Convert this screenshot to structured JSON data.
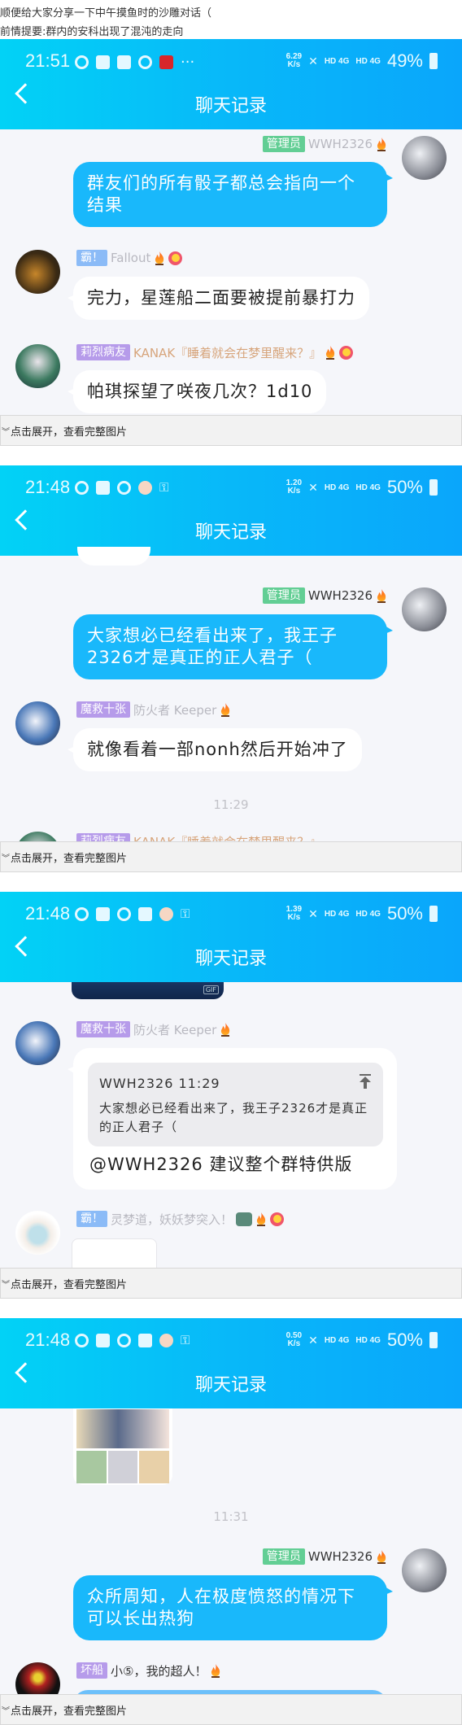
{
  "intro": {
    "line1": "顺便给大家分享一下中午摸鱼时的沙雕对话（",
    "line2": "前情提要:群内的安科出现了混沌的走向"
  },
  "colors": {
    "header_start": "#02d2f6",
    "header_end": "#0aa6fb",
    "bubble_self": "#19b8fb",
    "badge_admin": "#62ce94",
    "badge_blue": "#8bbbf7",
    "badge_purple": "#b69bea",
    "background": "#f5f6fa"
  },
  "expand_label": "点击展开，查看完整图片",
  "panels": [
    {
      "status": {
        "time": "21:51",
        "speed_top": "6.29",
        "speed_unit": "K/s",
        "net1": "HD 4G",
        "net2": "HD 4G",
        "battery": "49%"
      },
      "title": "聊天记录",
      "messages": [
        {
          "side": "right",
          "badge": "管理员",
          "name": "WWH2326",
          "text": "群友们的所有骰子都总会指向一个结果"
        },
        {
          "side": "left",
          "badge": "霸！",
          "name": "Fallout",
          "text": "完力，星莲船二面要被提前暴打力"
        },
        {
          "side": "left",
          "badge": "莉烈病友",
          "name": "KANAK『睡着就会在梦里醒来？』",
          "text": "帕琪探望了咲夜几次？1d10"
        }
      ]
    },
    {
      "status": {
        "time": "21:48",
        "speed_top": "1.20",
        "speed_unit": "K/s",
        "net1": "HD 4G",
        "net2": "HD 4G",
        "battery": "50%"
      },
      "title": "聊天记录",
      "messages": [
        {
          "side": "right",
          "badge": "管理员",
          "name": "WWH2326",
          "text": "大家想必已经看出来了，我王子2326才是真正的正人君子（"
        },
        {
          "side": "left",
          "badge": "魔救十张",
          "name": "防火者 Keeper",
          "text": "就像看着一部nonh然后开始冲了"
        },
        {
          "side": "left",
          "badge": "莉烈病友",
          "name": "KANAK『睡着就会在梦里醒来？』"
        }
      ],
      "timestamp": "11:29"
    },
    {
      "status": {
        "time": "21:48",
        "speed_top": "1.39",
        "speed_unit": "K/s",
        "net1": "HD 4G",
        "net2": "HD 4G",
        "battery": "50%"
      },
      "title": "聊天记录",
      "messages": [
        {
          "side": "left",
          "badge": "魔救十张",
          "name": "防火者 Keeper",
          "quote": {
            "header": "WWH2326 11:29",
            "text": "大家想必已经看出来了，我王子2326才是真正的正人君子（"
          },
          "text": "@WWH2326 建议整个群特供版"
        },
        {
          "side": "left",
          "badge": "霸！",
          "name": "灵梦道，妖妖梦突入！"
        }
      ],
      "gif_label": "GIF"
    },
    {
      "status": {
        "time": "21:48",
        "speed_top": "0.50",
        "speed_unit": "K/s",
        "net1": "HD 4G",
        "net2": "HD 4G",
        "battery": "50%"
      },
      "title": "聊天记录",
      "timestamp": "11:31",
      "messages": [
        {
          "side": "right",
          "badge": "管理员",
          "name": "WWH2326",
          "text": "众所周知，人在极度愤怒的情况下可以长出热狗"
        },
        {
          "side": "left",
          "badge": "坏船",
          "name": "小⑤，我的超人！"
        }
      ]
    }
  ]
}
